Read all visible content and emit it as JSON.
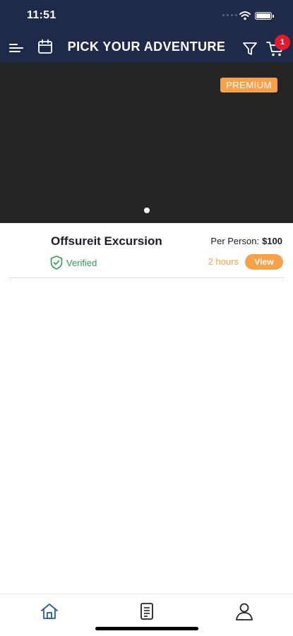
{
  "status_bar": {
    "time": "11:51"
  },
  "header": {
    "title": "PICK YOUR ADVENTURE",
    "cart_count": "1",
    "icons": [
      "menu-icon",
      "calendar-icon",
      "filter-icon",
      "cart-icon"
    ]
  },
  "hero": {
    "badge": "PREMIUM",
    "slide_index": 1,
    "slide_count": 1
  },
  "listing": {
    "title": "Offsureit Excursion",
    "verified_label": "Verified",
    "price_label": "Per Person:",
    "price_value": "$100",
    "duration": "2 hours",
    "view_label": "View"
  },
  "tab_bar": {
    "tabs": [
      {
        "name": "home",
        "icon": "home-icon",
        "active": true
      },
      {
        "name": "bookings",
        "icon": "document-icon",
        "active": false
      },
      {
        "name": "profile",
        "icon": "user-icon",
        "active": false
      }
    ]
  },
  "colors": {
    "header_bg": "#1f2a4a",
    "accent": "#f7a24a",
    "verified": "#2e9a57",
    "badge": "#e21b2c",
    "active_tab": "#2b5aa0"
  }
}
